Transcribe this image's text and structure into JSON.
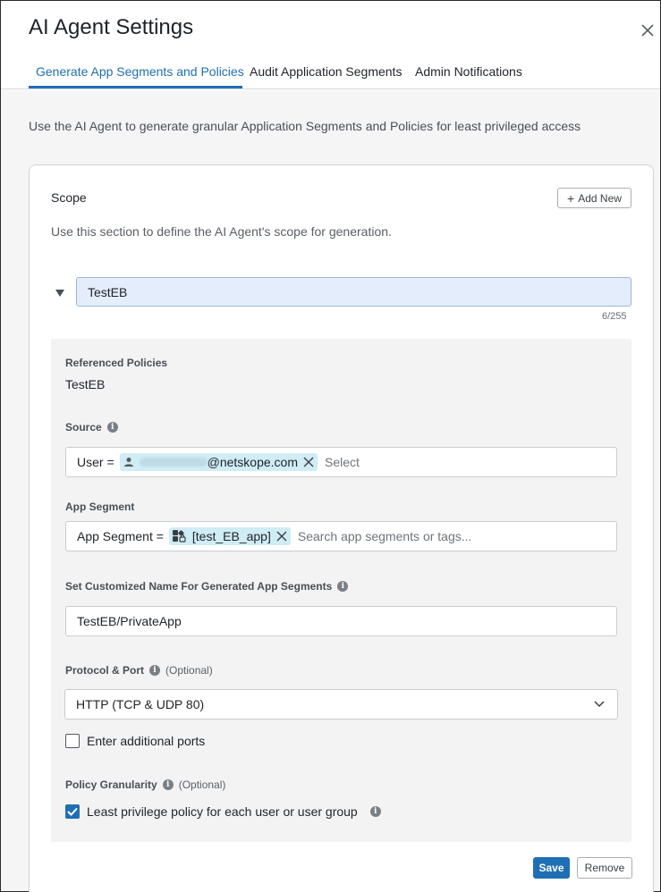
{
  "window": {
    "title": "AI Agent Settings"
  },
  "tabs": [
    {
      "label": "Generate App Segments and Policies",
      "active": true
    },
    {
      "label": "Audit Application Segments",
      "active": false
    },
    {
      "label": "Admin Notifications",
      "active": false
    }
  ],
  "intro": "Use the AI Agent to generate granular Application Segments and Policies for least privileged access",
  "scope": {
    "title": "Scope",
    "add_new_label": "Add New",
    "description": "Use this section to define the AI Agent's scope for generation.",
    "name_value": "TestEB",
    "char_counter": "6/255",
    "referenced_policies_label": "Referenced Policies",
    "referenced_policies_value": "TestEB",
    "source": {
      "label": "Source",
      "prefix": "User =",
      "chip_text": "@netskope.com",
      "placeholder": "Select"
    },
    "app_segment": {
      "label": "App Segment",
      "prefix": "App Segment =",
      "chip_text": "[test_EB_app]",
      "placeholder": "Search app segments or tags..."
    },
    "custom_name": {
      "label": "Set Customized Name For Generated App Segments",
      "value": "TestEB/PrivateApp"
    },
    "protocol_port": {
      "label": "Protocol & Port",
      "optional": "(Optional)",
      "selected": "HTTP (TCP & UDP 80)"
    },
    "additional_ports": {
      "label": "Enter additional ports",
      "checked": false
    },
    "policy_granularity": {
      "label": "Policy Granularity",
      "optional": "(Optional)",
      "option_label": "Least privilege policy for each user or user group",
      "checked": true
    }
  },
  "actions": {
    "save_label": "Save",
    "remove_label": "Remove"
  },
  "colors": {
    "accent": "#1f6fb5",
    "chip": "#d0ecf4",
    "input_highlight": "#e3edfb"
  }
}
